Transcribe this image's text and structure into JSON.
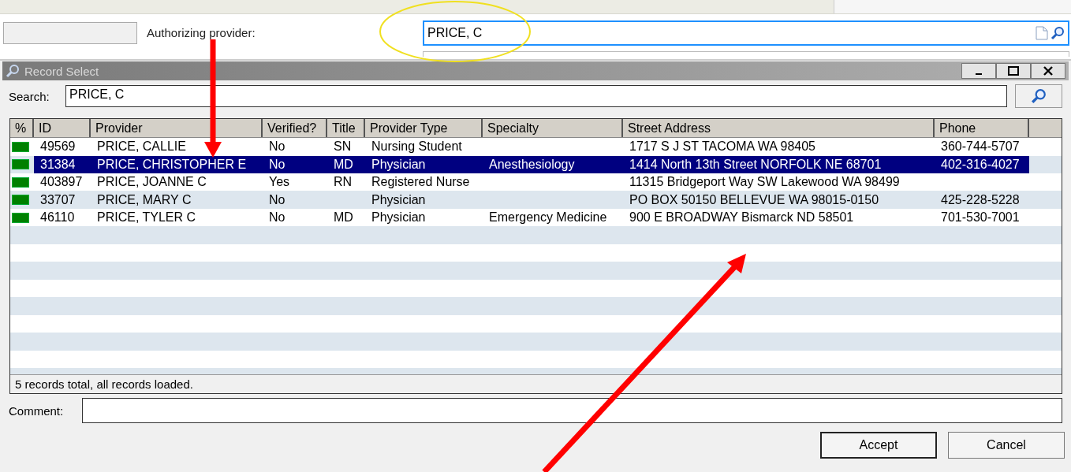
{
  "form": {
    "label": "Authorizing provider:",
    "value": "PRICE, C"
  },
  "dialog": {
    "title": "Record Select",
    "search_label": "Search:",
    "search_value": "PRICE, C",
    "columns": [
      "%",
      "ID",
      "Provider",
      "Verified?",
      "Title",
      "Provider Type",
      "Specialty",
      "Street Address",
      "Phone"
    ],
    "rows": [
      {
        "id": "49569",
        "provider": "PRICE, CALLIE",
        "verified": "No",
        "title": "SN",
        "provider_type": "Nursing Student",
        "specialty": "",
        "address": "1717 S J ST TACOMA WA 98405",
        "phone": "360-744-5707",
        "selected": false
      },
      {
        "id": "31384",
        "provider": "PRICE, CHRISTOPHER E",
        "verified": "No",
        "title": "MD",
        "provider_type": "Physician",
        "specialty": "Anesthesiology",
        "address": "1414 North 13th Street NORFOLK NE 68701",
        "phone": "402-316-4027",
        "selected": true
      },
      {
        "id": "403897",
        "provider": "PRICE, JOANNE C",
        "verified": "Yes",
        "title": "RN",
        "provider_type": "Registered Nurse",
        "specialty": "",
        "address": "11315 Bridgeport Way SW Lakewood WA 98499",
        "phone": "",
        "selected": false
      },
      {
        "id": "33707",
        "provider": "PRICE, MARY C",
        "verified": "No",
        "title": "",
        "provider_type": "Physician",
        "specialty": "",
        "address": "PO BOX 50150 BELLEVUE WA 98015-0150",
        "phone": "425-228-5228",
        "selected": false
      },
      {
        "id": "46110",
        "provider": "PRICE, TYLER C",
        "verified": "No",
        "title": "MD",
        "provider_type": "Physician",
        "specialty": "Emergency Medicine",
        "address": "900 E BROADWAY Bismarck ND 58501",
        "phone": "701-530-7001",
        "selected": false
      }
    ],
    "status": "5 records total, all records loaded.",
    "comment_label": "Comment:",
    "buttons": [
      "Accept",
      "Cancel"
    ]
  }
}
